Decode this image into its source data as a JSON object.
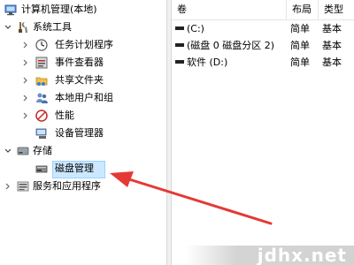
{
  "tree": {
    "root_label": "计算机管理(本地)",
    "system_tools_label": "系统工具",
    "task_scheduler_label": "任务计划程序",
    "event_viewer_label": "事件查看器",
    "shared_folders_label": "共享文件夹",
    "local_users_label": "本地用户和组",
    "performance_label": "性能",
    "device_manager_label": "设备管理器",
    "storage_label": "存储",
    "disk_management_label": "磁盘管理",
    "services_label": "服务和应用程序"
  },
  "list": {
    "columns": [
      "卷",
      "布局",
      "类型"
    ],
    "rows": [
      {
        "volume": "(C:)",
        "layout": "简单",
        "type": "基本"
      },
      {
        "volume": "(磁盘 0 磁盘分区 2)",
        "layout": "简单",
        "type": "基本"
      },
      {
        "volume": "软件 (D:)",
        "layout": "简单",
        "type": "基本"
      }
    ]
  },
  "watermark": "jdhx.net",
  "colors": {
    "selection": "#cce8ff",
    "arrow": "#e53935"
  }
}
